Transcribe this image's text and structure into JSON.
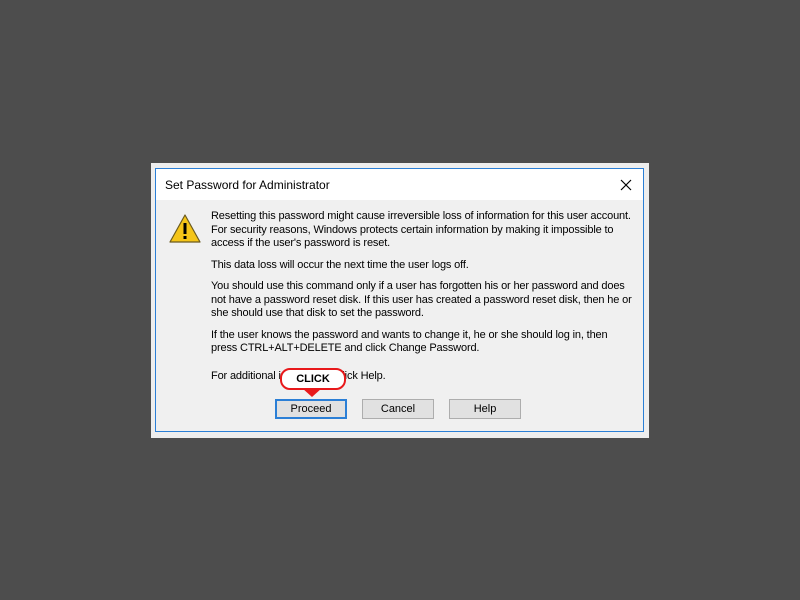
{
  "dialog": {
    "title": "Set Password for Administrator",
    "close_icon": "close-icon",
    "warning_icon": "warning-triangle-icon",
    "paragraphs": [
      "Resetting this password might cause irreversible loss of information for this user account. For security reasons, Windows protects certain information by making it impossible to access if the user's password is reset.",
      "This data loss will occur the next time the user logs off.",
      "You should use this command only if a user has forgotten his or her password and does not have a password reset disk. If this user has created a password reset disk, then he or she should use that disk to set the password.",
      "If the user knows the password and wants to change it, he or she should log in, then press CTRL+ALT+DELETE and click Change Password.",
      "For additional information, click Help."
    ],
    "buttons": {
      "proceed": "Proceed",
      "cancel": "Cancel",
      "help": "Help"
    }
  },
  "annotation": {
    "label": "CLICK",
    "color": "#e8191b"
  },
  "colors": {
    "background": "#4d4d4d",
    "accent": "#2b7fd6",
    "dialog_body": "#f0f0f0"
  }
}
